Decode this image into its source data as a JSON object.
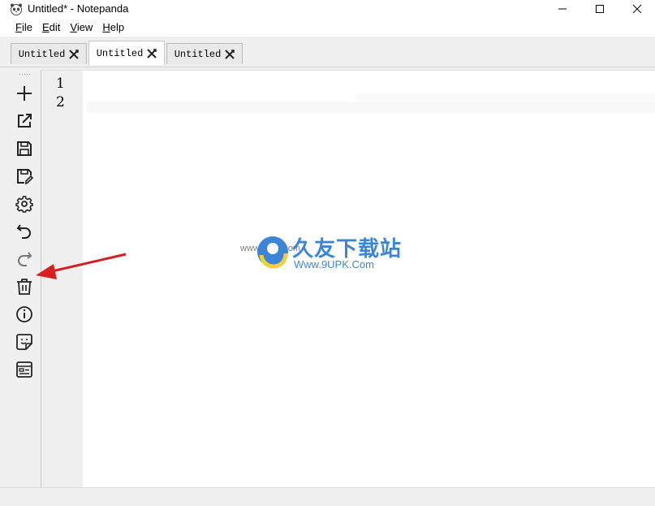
{
  "window": {
    "title": "Untitled* - Notepanda"
  },
  "menu": [
    {
      "key": "file",
      "accel": "F",
      "rest": "ile"
    },
    {
      "key": "edit",
      "accel": "E",
      "rest": "dit"
    },
    {
      "key": "view",
      "accel": "V",
      "rest": "iew"
    },
    {
      "key": "help",
      "accel": "H",
      "rest": "elp"
    }
  ],
  "tabs": [
    {
      "label": "Untitled",
      "active": false
    },
    {
      "label": "Untitled",
      "active": true
    },
    {
      "label": "Untitled",
      "active": false
    }
  ],
  "toolbar": {
    "icons": [
      "new-icon",
      "open-external-icon",
      "save-icon",
      "save-as-icon",
      "settings-icon",
      "undo-icon",
      "redo-icon",
      "trash-icon",
      "info-icon",
      "sticker-icon",
      "layout-icon"
    ]
  },
  "editor": {
    "line_numbers": [
      "1",
      "2"
    ],
    "content": ""
  },
  "watermark": {
    "title": "久友下载站",
    "url": "Www.9UPK.Com",
    "small": "www.9upk.com"
  }
}
